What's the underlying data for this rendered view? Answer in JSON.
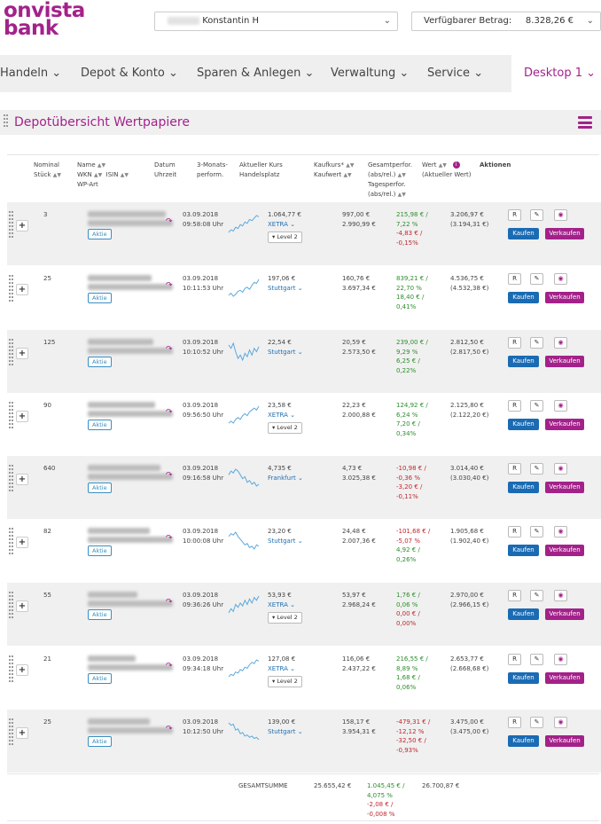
{
  "brand": {
    "line1": "onvista",
    "line2": "bank"
  },
  "account_selector": {
    "label_blurred": "327982",
    "name": "Konstantin H"
  },
  "available_amount": {
    "label": "Verfügbarer Betrag:",
    "value": "8.328,26 €"
  },
  "nav": [
    {
      "label": "Handeln"
    },
    {
      "label": "Depot & Konto"
    },
    {
      "label": "Sparen & Anlegen"
    },
    {
      "label": "Verwaltung"
    },
    {
      "label": "Service"
    },
    {
      "label": "Desktop 1"
    }
  ],
  "panel": {
    "title": "Depotübersicht Wertpapiere"
  },
  "columns": {
    "nominal": "Nominal",
    "stueck": "Stück",
    "name": "Name",
    "wkn": "WKN",
    "isin": "ISIN",
    "wp_art": "WP-Art",
    "datum": "Datum",
    "uhrzeit": "Uhrzeit",
    "perf3m_a": "3-Monats-",
    "perf3m_b": "perform.",
    "kurs_a": "Aktueller Kurs",
    "kurs_b": "Handelsplatz",
    "kaufkurs": "Kaufkurs*",
    "kaufwert": "Kaufwert",
    "gesamt_a": "Gesamtperfor.",
    "gesamt_b": "(abs/rel.)",
    "tages_a": "Tagesperfor.",
    "tages_b": "(abs/rel.)",
    "wert_a": "Wert",
    "wert_b": "(Aktueller Wert)",
    "aktionen": "Aktionen"
  },
  "labels": {
    "aktie": "Aktie",
    "level2": "Level 2",
    "kaufen": "Kaufen",
    "verkaufen": "Verkaufen",
    "r": "R",
    "total": "GESAMTSUMME",
    "plus": "+",
    "share_icon": "share-arrow"
  },
  "positions": [
    {
      "qty": "3",
      "date": "03.09.2018",
      "time": "09:58:08 Uhr",
      "price": "1.064,77 €",
      "exchange": "XETRA",
      "level2": true,
      "buy_price": "997,00 €",
      "buy_value": "2.990,99 €",
      "perf_total_abs": "215,98 € /",
      "perf_total_rel": "7,22 %",
      "perf_day_abs": "-4,83 € /",
      "perf_day_rel": "-0,15%",
      "total_sign": "pos",
      "day_sign": "neg",
      "value": "3.206,97 €",
      "value_prev": "(3.194,31 €)",
      "spark": [
        6,
        8,
        7,
        10,
        9,
        12,
        11,
        14,
        13,
        16,
        15,
        17,
        19,
        18
      ]
    },
    {
      "qty": "25",
      "date": "03.09.2018",
      "time": "10:11:53 Uhr",
      "price": "197,06 €",
      "exchange": "Stuttgart",
      "level2": false,
      "buy_price": "160,76 €",
      "buy_value": "3.697,34 €",
      "perf_total_abs": "839,21 € /",
      "perf_total_rel": "22,70 %",
      "perf_day_abs": "18,40 € /",
      "perf_day_rel": "0,41%",
      "total_sign": "pos",
      "day_sign": "pos",
      "value": "4.536,75 €",
      "value_prev": "(4.532,38 €)",
      "spark": [
        4,
        6,
        3,
        5,
        8,
        9,
        7,
        11,
        12,
        10,
        14,
        17,
        16,
        20
      ]
    },
    {
      "qty": "125",
      "date": "03.09.2018",
      "time": "10:10:52 Uhr",
      "price": "22,54 €",
      "exchange": "Stuttgart",
      "level2": false,
      "buy_price": "20,59 €",
      "buy_value": "2.573,50 €",
      "perf_total_abs": "239,00 € /",
      "perf_total_rel": "9,29 %",
      "perf_day_abs": "6,25 € /",
      "perf_day_rel": "0,22%",
      "total_sign": "pos",
      "day_sign": "pos",
      "value": "2.812,50 €",
      "value_prev": "(2.817,50 €)",
      "spark": [
        14,
        12,
        15,
        10,
        6,
        8,
        5,
        9,
        7,
        11,
        8,
        12,
        10,
        13
      ]
    },
    {
      "qty": "90",
      "date": "03.09.2018",
      "time": "09:56:50 Uhr",
      "price": "23,58 €",
      "exchange": "XETRA",
      "level2": true,
      "buy_price": "22,23 €",
      "buy_value": "2.000,88 €",
      "perf_total_abs": "124,92 € /",
      "perf_total_rel": "6,24 %",
      "perf_day_abs": "7,20 € /",
      "perf_day_rel": "0,34%",
      "total_sign": "pos",
      "day_sign": "pos",
      "value": "2.125,80 €",
      "value_prev": "(2.122,20 €)",
      "spark": [
        5,
        6,
        5,
        7,
        8,
        7,
        9,
        10,
        9,
        11,
        12,
        13,
        12,
        14
      ]
    },
    {
      "qty": "640",
      "date": "03.09.2018",
      "time": "09:16:58 Uhr",
      "price": "4,735 €",
      "exchange": "Frankfurt",
      "level2": false,
      "buy_price": "4,73 €",
      "buy_value": "3.025,38 €",
      "perf_total_abs": "-10,98 € /",
      "perf_total_rel": "-0,36 %",
      "perf_day_abs": "-3,20 € /",
      "perf_day_rel": "-0,11%",
      "total_sign": "neg",
      "day_sign": "neg",
      "value": "3.014,40 €",
      "value_prev": "(3.030,40 €)",
      "spark": [
        12,
        14,
        13,
        15,
        14,
        12,
        10,
        11,
        8,
        9,
        7,
        8,
        6,
        7
      ]
    },
    {
      "qty": "82",
      "date": "03.09.2018",
      "time": "10:00:08 Uhr",
      "price": "23,20 €",
      "exchange": "Stuttgart",
      "level2": false,
      "buy_price": "24,48 €",
      "buy_value": "2.007,36 €",
      "perf_total_abs": "-101,68 € /",
      "perf_total_rel": "-5,07 %",
      "perf_day_abs": "4,92 € /",
      "perf_day_rel": "0,26%",
      "total_sign": "neg",
      "day_sign": "pos",
      "value": "1.905,68 €",
      "value_prev": "(1.902,40 €)",
      "spark": [
        14,
        16,
        15,
        17,
        14,
        12,
        10,
        8,
        9,
        6,
        7,
        5,
        8,
        7
      ]
    },
    {
      "qty": "55",
      "date": "03.09.2018",
      "time": "09:36:26 Uhr",
      "price": "53,93 €",
      "exchange": "XETRA",
      "level2": true,
      "buy_price": "53,97 €",
      "buy_value": "2.968,24 €",
      "perf_total_abs": "1,76 € /",
      "perf_total_rel": "0,06 %",
      "perf_day_abs": "0,00 € /",
      "perf_day_rel": "0,00%",
      "total_sign": "pos",
      "day_sign": "neg",
      "value": "2.970,00 €",
      "value_prev": "(2.966,15 €)",
      "spark": [
        5,
        8,
        6,
        11,
        9,
        12,
        10,
        14,
        11,
        15,
        12,
        16,
        14,
        17
      ]
    },
    {
      "qty": "21",
      "date": "03.09.2018",
      "time": "09:34:18 Uhr",
      "price": "127,08 €",
      "exchange": "XETRA",
      "level2": true,
      "buy_price": "116,06 €",
      "buy_value": "2.437,22 €",
      "perf_total_abs": "216,55 € /",
      "perf_total_rel": "8,89 %",
      "perf_day_abs": "1,68 € /",
      "perf_day_rel": "0,06%",
      "total_sign": "pos",
      "day_sign": "pos",
      "value": "2.653,77 €",
      "value_prev": "(2.668,68 €)",
      "spark": [
        4,
        6,
        5,
        8,
        7,
        10,
        9,
        12,
        11,
        14,
        16,
        15,
        18,
        17
      ]
    },
    {
      "qty": "25",
      "date": "03.09.2018",
      "time": "10:12:50 Uhr",
      "price": "139,00 €",
      "exchange": "Stuttgart",
      "level2": false,
      "buy_price": "158,17 €",
      "buy_value": "3.954,31 €",
      "perf_total_abs": "-479,31 € /",
      "perf_total_rel": "-12,12 %",
      "perf_day_abs": "-32,50 € /",
      "perf_day_rel": "-0,93%",
      "total_sign": "neg",
      "day_sign": "neg",
      "value": "3.475,00 €",
      "value_prev": "(3.475,00 €)",
      "spark": [
        18,
        16,
        17,
        12,
        13,
        9,
        10,
        7,
        8,
        6,
        7,
        5,
        6,
        4
      ]
    }
  ],
  "totals": {
    "buy_value": "25.655,42 €",
    "perf_total_abs": "1.045,45 € /",
    "perf_total_rel": "4,075 %",
    "perf_day_abs": "-2,08 € /",
    "perf_day_rel": "-0,008 %",
    "value": "26.700,87 €"
  },
  "colors": {
    "brand": "#a3228a",
    "buy": "#1a6bb3",
    "positive": "#2a8f2a",
    "negative": "#c0262d",
    "exchange": "#1f6fb0"
  }
}
